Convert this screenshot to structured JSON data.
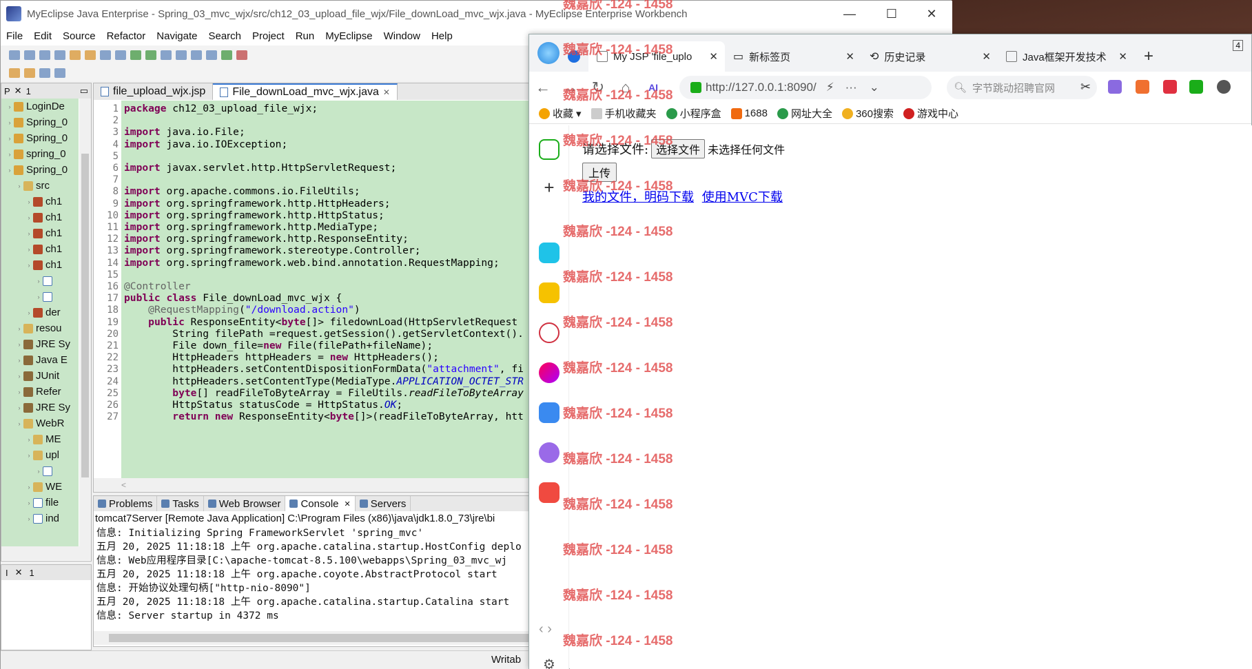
{
  "eclipse": {
    "title": "MyEclipse Java Enterprise - Spring_03_mvc_wjx/src/ch12_03_upload_file_wjx/File_downLoad_mvc_wjx.java - MyEclipse Enterprise Workbench",
    "menu": [
      "File",
      "Edit",
      "Source",
      "Refactor",
      "Navigate",
      "Search",
      "Project",
      "Run",
      "MyEclipse",
      "Window",
      "Help"
    ],
    "package_explorer": {
      "tab": "P",
      "tab2": "1",
      "items": [
        {
          "label": "LoginDe",
          "icon": "project-icon",
          "indent": 0
        },
        {
          "label": "Spring_0",
          "icon": "project-icon",
          "indent": 0
        },
        {
          "label": "Spring_0",
          "icon": "project-icon",
          "indent": 0
        },
        {
          "label": "spring_0",
          "icon": "project-icon",
          "indent": 0
        },
        {
          "label": "Spring_0",
          "icon": "project-icon",
          "indent": 0
        },
        {
          "label": "src",
          "icon": "folder-icon",
          "indent": 1
        },
        {
          "label": "ch1",
          "icon": "package-icon",
          "indent": 2
        },
        {
          "label": "ch1",
          "icon": "package-icon",
          "indent": 2
        },
        {
          "label": "ch1",
          "icon": "package-icon",
          "indent": 2
        },
        {
          "label": "ch1",
          "icon": "package-icon",
          "indent": 2
        },
        {
          "label": "ch1",
          "icon": "package-icon",
          "indent": 2
        },
        {
          "label": "",
          "icon": "java-file-icon",
          "indent": 3
        },
        {
          "label": "",
          "icon": "java-file-icon",
          "indent": 3
        },
        {
          "label": "der",
          "icon": "package-icon",
          "indent": 2
        },
        {
          "label": "resou",
          "icon": "folder-icon",
          "indent": 1
        },
        {
          "label": "JRE Sy",
          "icon": "library-icon",
          "indent": 1
        },
        {
          "label": "Java E",
          "icon": "library-icon",
          "indent": 1
        },
        {
          "label": "JUnit",
          "icon": "library-icon",
          "indent": 1
        },
        {
          "label": "Refer",
          "icon": "library-icon",
          "indent": 1
        },
        {
          "label": "JRE Sy",
          "icon": "library-icon",
          "indent": 1
        },
        {
          "label": "WebR",
          "icon": "folder-icon",
          "indent": 1
        },
        {
          "label": "ME",
          "icon": "folder-icon",
          "indent": 2
        },
        {
          "label": "upl",
          "icon": "folder-icon",
          "indent": 2
        },
        {
          "label": "",
          "icon": "file-icon",
          "indent": 3
        },
        {
          "label": "WE",
          "icon": "folder-icon",
          "indent": 2
        },
        {
          "label": "file",
          "icon": "jsp-file-icon",
          "indent": 2
        },
        {
          "label": "ind",
          "icon": "jsp-file-icon",
          "indent": 2
        }
      ]
    },
    "outline": {
      "tab": "I",
      "tab2": "1"
    },
    "editor": {
      "tabs": [
        {
          "label": "file_upload_wjx.jsp",
          "active": false
        },
        {
          "label": "File_downLoad_mvc_wjx.java",
          "active": true
        }
      ],
      "lines": [
        {
          "n": "1",
          "html": "<span class='kw'>package</span> ch12_03_upload_file_wjx;"
        },
        {
          "n": "2",
          "html": ""
        },
        {
          "n": "3",
          "html": "<span class='kw'>import</span> java.io.File;"
        },
        {
          "n": "4",
          "html": "<span class='kw'>import</span> java.io.IOException;"
        },
        {
          "n": "5",
          "html": ""
        },
        {
          "n": "6",
          "html": "<span class='kw'>import</span> javax.servlet.http.HttpServletRequest;"
        },
        {
          "n": "7",
          "html": ""
        },
        {
          "n": "8",
          "html": "<span class='kw'>import</span> org.apache.commons.io.FileUtils;"
        },
        {
          "n": "9",
          "html": "<span class='kw'>import</span> org.springframework.http.HttpHeaders;"
        },
        {
          "n": "10",
          "html": "<span class='kw'>import</span> org.springframework.http.HttpStatus;"
        },
        {
          "n": "11",
          "html": "<span class='kw'>import</span> org.springframework.http.MediaType;"
        },
        {
          "n": "12",
          "html": "<span class='kw'>import</span> org.springframework.http.ResponseEntity;"
        },
        {
          "n": "13",
          "html": "<span class='kw'>import</span> org.springframework.stereotype.Controller;"
        },
        {
          "n": "14",
          "html": "<span class='kw'>import</span> org.springframework.web.bind.annotation.RequestMapping;"
        },
        {
          "n": "15",
          "html": ""
        },
        {
          "n": "16",
          "html": "<span class='an'>@Controller</span>"
        },
        {
          "n": "17",
          "html": "<span class='kw'>public class</span> File_downLoad_mvc_wjx {"
        },
        {
          "n": "18",
          "html": "    <span class='an'>@RequestMapping</span>(<span class='st'>\"/download.action\"</span>)"
        },
        {
          "n": "19",
          "html": "    <span class='kw'>public</span> ResponseEntity&lt;<span class='kw'>byte</span>[]&gt; filedownLoad(HttpServletRequest"
        },
        {
          "n": "20",
          "html": "        String filePath =request.getSession().getServletContext()."
        },
        {
          "n": "21",
          "html": "        File down_file=<span class='kw'>new</span> File(filePath+fileName);"
        },
        {
          "n": "22",
          "html": "        HttpHeaders httpHeaders = <span class='kw'>new</span> HttpHeaders();"
        },
        {
          "n": "23",
          "html": "        httpHeaders.setContentDispositionFormData(<span class='st'>\"attachment\"</span>, fi"
        },
        {
          "n": "24",
          "html": "        httpHeaders.setContentType(MediaType.<span class='it'>APPLICATION_OCTET_STR</span>"
        },
        {
          "n": "25",
          "html": "        <span class='kw'>byte</span>[] readFileToByteArray = FileUtils.<i>readFileToByteArray</i>"
        },
        {
          "n": "26",
          "html": "        HttpStatus statusCode = HttpStatus.<span class='it'>OK</span>;"
        },
        {
          "n": "27",
          "html": "        <span class='kw'>return new</span> ResponseEntity&lt;<span class='kw'>byte</span>[]&gt;(readFileToByteArray, htt"
        }
      ]
    },
    "console": {
      "tabs": [
        {
          "label": "Problems",
          "active": false
        },
        {
          "label": "Tasks",
          "active": false
        },
        {
          "label": "Web Browser",
          "active": false
        },
        {
          "label": "Console",
          "active": true
        },
        {
          "label": "Servers",
          "active": false
        }
      ],
      "header": "tomcat7Server [Remote Java Application] C:\\Program Files (x86)\\java\\jdk1.8.0_73\\jre\\bi",
      "lines": [
        "信息: Initializing Spring FrameworkServlet 'spring_mvc'",
        "五月 20, 2025 11:18:18 上午 org.apache.catalina.startup.HostConfig deplo",
        "信息: Web应用程序目录[C:\\apache-tomcat-8.5.100\\webapps\\Spring_03_mvc_wj",
        "五月 20, 2025 11:18:18 上午 org.apache.coyote.AbstractProtocol start",
        "信息: 开始协议处理句柄[\"http-nio-8090\"]",
        "五月 20, 2025 11:18:18 上午 org.apache.catalina.startup.Catalina start",
        "信息: Server startup in 4372 ms"
      ]
    },
    "status": {
      "writable": "Writab"
    }
  },
  "browser": {
    "tab_count": "4",
    "tabs": [
      {
        "label": "My JSP 'file_uplo",
        "active": true
      },
      {
        "label": "新标签页",
        "active": false
      },
      {
        "label": "历史记录",
        "active": false
      },
      {
        "label": "Java框架开发技术",
        "active": false
      }
    ],
    "url": "http://127.0.0.1:8090/",
    "search_placeholder": "字节跳动招聘官网",
    "bookmarks": [
      "收藏",
      "手机收藏夹",
      "小程序盒",
      "1688",
      "网址大全",
      "360搜索",
      "游戏中心"
    ],
    "page": {
      "file_label": "请选择文件:",
      "file_button": "选择文件",
      "file_none": "未选择任何文件",
      "upload_button": "上传",
      "link1": "我的文件，明码下载",
      "link2": "使用MVC下载"
    }
  },
  "watermark": "魏嘉欣 -124 - 1458",
  "colors": {
    "editor_bg": "#c7e7c7",
    "keyword": "#7f0055",
    "string": "#2a00ff",
    "link": "#0000ee",
    "watermark": "#e04444"
  }
}
